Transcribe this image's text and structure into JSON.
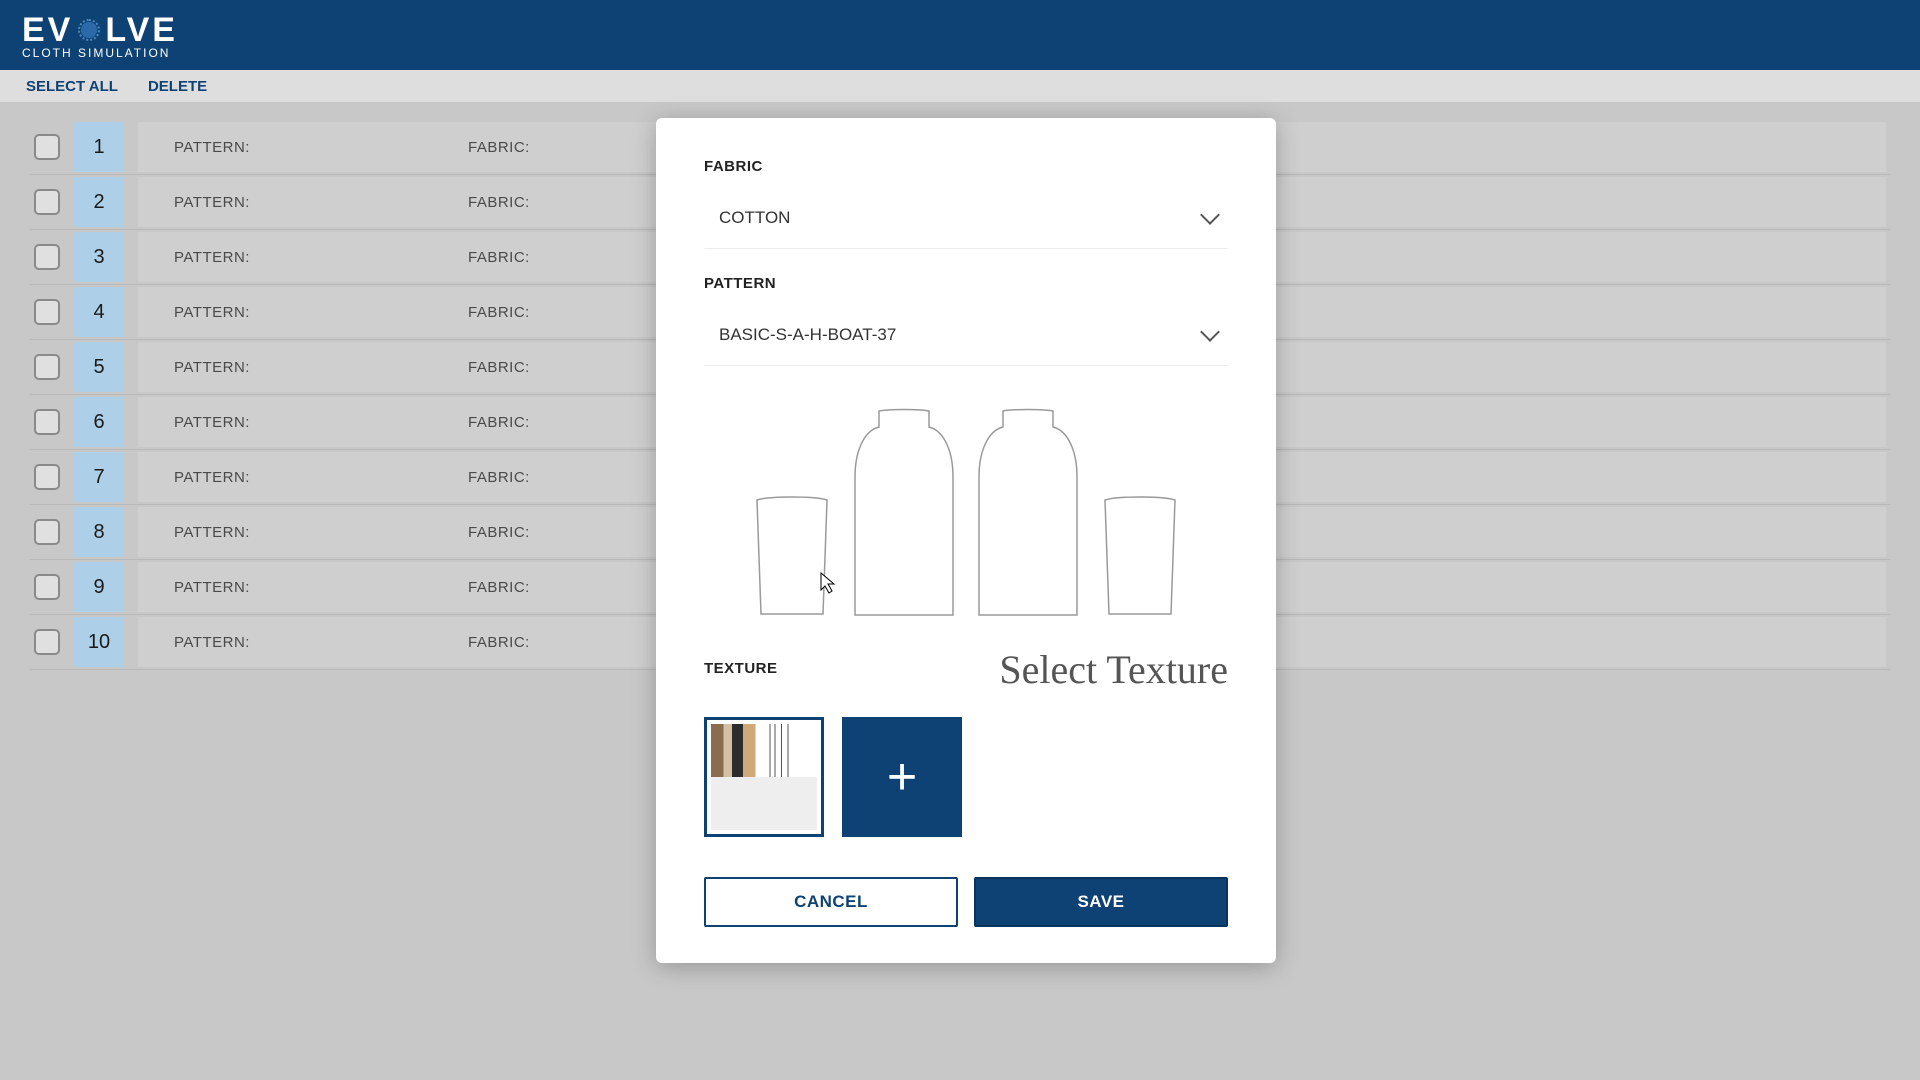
{
  "app": {
    "logo_left": "EV",
    "logo_right": "LVE",
    "subtitle": "CLOTH SIMULATION"
  },
  "toolbar": {
    "select_all": "SELECT ALL",
    "delete": "DELETE"
  },
  "list": {
    "pattern_label": "PATTERN:",
    "fabric_label": "FABRIC:",
    "rows": [
      {
        "n": "1"
      },
      {
        "n": "2"
      },
      {
        "n": "3"
      },
      {
        "n": "4"
      },
      {
        "n": "5"
      },
      {
        "n": "6"
      },
      {
        "n": "7"
      },
      {
        "n": "8"
      },
      {
        "n": "9"
      },
      {
        "n": "10"
      }
    ]
  },
  "modal": {
    "fabric_label": "FABRIC",
    "fabric_value": "COTTON",
    "pattern_label": "PATTERN",
    "pattern_value": "BASIC-S-A-H-BOAT-37",
    "texture_label": "TEXTURE",
    "select_texture": "Select Texture",
    "add_icon": "+",
    "cancel": "CANCEL",
    "save": "SAVE"
  }
}
